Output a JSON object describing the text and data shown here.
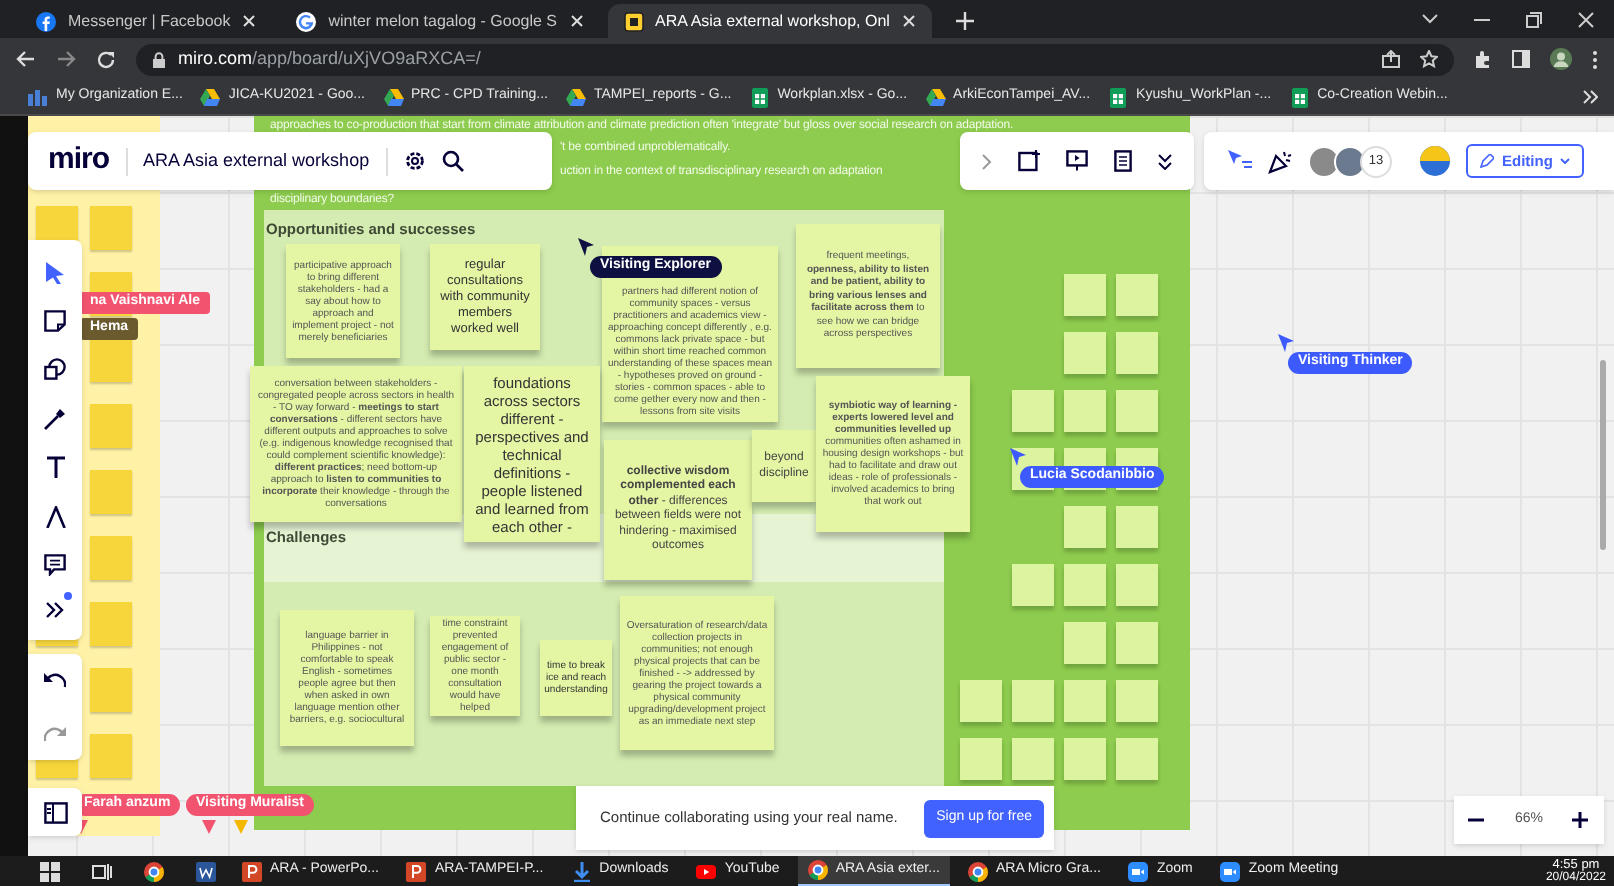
{
  "browser": {
    "tabs": [
      {
        "kind": "facebook",
        "label": "Messenger | Facebook",
        "selected": false
      },
      {
        "kind": "google",
        "label": "winter melon tagalog - Google S",
        "selected": false
      },
      {
        "kind": "miro",
        "label": "ARA Asia external workshop, Onl",
        "selected": true
      }
    ],
    "address": {
      "host": "miro.com",
      "path": "/app/board/uXjVO9aRXCA=/"
    },
    "bookmarks": [
      {
        "kind": "org",
        "label": "My Organization E..."
      },
      {
        "kind": "drive",
        "label": "JICA-KU2021 - Goo..."
      },
      {
        "kind": "drive",
        "label": "PRC - CPD Training..."
      },
      {
        "kind": "drive",
        "label": "TAMPEI_reports - G..."
      },
      {
        "kind": "sheets",
        "label": "Workplan.xlsx - Go..."
      },
      {
        "kind": "drive",
        "label": "ArkiEconTampei_AV..."
      },
      {
        "kind": "sheets",
        "label": "Kyushu_WorkPlan -..."
      },
      {
        "kind": "sheets",
        "label": "Co-Creation Webin..."
      }
    ]
  },
  "board": {
    "logo": "miro",
    "title": "ARA Asia external workshop",
    "collaborator_count": "13",
    "mode": "Editing",
    "tools": [
      {
        "kind": "select",
        "selected": true,
        "notification": false
      },
      {
        "kind": "sticky",
        "selected": false,
        "notification": false
      },
      {
        "kind": "shapes",
        "selected": false,
        "notification": false
      },
      {
        "kind": "pen",
        "selected": false,
        "notification": false
      },
      {
        "kind": "text",
        "selected": false,
        "notification": false
      },
      {
        "kind": "font",
        "selected": false,
        "notification": false
      },
      {
        "kind": "comment",
        "selected": false,
        "notification": false
      },
      {
        "kind": "more",
        "selected": false,
        "notification": true
      }
    ],
    "frame_lines": [
      "approaches to co-production that start from climate attribution and climate prediction often 'integrate' but gloss over social research on adaptation.",
      "'t be combined unproblematically.",
      "uction in the context of transdisciplinary research on adaptation",
      "disciplinary boundaries?"
    ],
    "headings": [
      "Opportunities and successes",
      "Challenges"
    ],
    "stickies": [
      {
        "text": "participative approach to bring different stakeholders - had a say about how to approach and implement project - not merely beneficiaries"
      },
      {
        "text": "regular consultations with community members worked well"
      },
      {
        "text": "partners had different notion of community spaces - versus practitioners and academics view - approaching concept differently , e.g. commons lack private space - but within short time reached common understanding of these spaces mean - hypotheses proved on ground - stories - common spaces - able to come gether every now and then - lessons from site visits"
      },
      {
        "text": "frequent meetings, **openness, ability to listen and be patient, ability to bring various lenses and facilitate across them** to see how we can bridge across perspectives"
      },
      {
        "text": "conversation between stakeholders - congregated people across sectors in health - TO way forward - **meetings to start conversations** - different sectors have different outputs and approaches to solve (e.g. indigenous knowledge recognised that could complement scientific knowledge): **different practices**; need bottom-up approach to **listen to communities to incorporate** their knowledge - through the conversations"
      },
      {
        "text": "foundations across sectors different - perspectives and technical definitions - people listened and learned from each other -"
      },
      {
        "text": "**collective wisdom complemented each other** - differences between fields were not hindering - maximised outcomes"
      },
      {
        "text": "beyond discipline"
      },
      {
        "text": "**symbiotic way of learning - experts lowered level and communities levelled up** communities often ashamed in housing design workshops - but had to facilitate and draw out ideas - role of professionals - involved academics to bring that work out"
      },
      {
        "text": "language barrier in Philippines - not comfortable to speak English - sometimes people agree but then when asked in own language mention other barriers, e.g. sociocultural"
      },
      {
        "text": "time constraint prevented engagement of public sector - one month consultation would have helped"
      },
      {
        "text": "time to break ice and reach understanding"
      },
      {
        "text": "Oversaturation of research/data collection projects in communities; not enough physical projects that can be finished - -> addressed by gearing the project towards a physical community upgrading/development project as an immediate next step"
      }
    ],
    "cursors": [
      {
        "kind": "tag",
        "name": "na Vaishnavi Ale",
        "color": "#f2546f"
      },
      {
        "kind": "tag",
        "name": "Hema",
        "color": "#6b5a2e"
      },
      {
        "kind": "arrow",
        "name": "Visiting Explorer",
        "color": "#0d1040"
      },
      {
        "kind": "arrow",
        "name": "Lucia Scodanibbio",
        "color": "#3d5afe"
      },
      {
        "kind": "arrow",
        "name": "Visiting Thinker",
        "color": "#3d5afe"
      },
      {
        "kind": "offscreen",
        "name": "Farah anzum",
        "color": "#f2546f"
      },
      {
        "kind": "offscreen",
        "name": "Visiting Muralist",
        "color": "#f2546f"
      },
      {
        "kind": "offscreen",
        "color": "#f5b800"
      }
    ],
    "signup": {
      "message": "Continue collaborating using your real name.",
      "button": "Sign up for free"
    },
    "zoom": "66%"
  },
  "taskbar": {
    "apps": [
      {
        "kind": "windows",
        "selected": false
      },
      {
        "kind": "taskview",
        "selected": false
      },
      {
        "kind": "chrome",
        "selected": false
      },
      {
        "kind": "word",
        "selected": false
      },
      {
        "kind": "powerpoint",
        "label": "ARA - PowerPo...",
        "selected": false
      },
      {
        "kind": "powerpoint",
        "label": "ARA-TAMPEI-P...",
        "selected": false
      },
      {
        "kind": "downloads",
        "label": "Downloads",
        "selected": false
      },
      {
        "kind": "youtube",
        "label": "YouTube",
        "selected": false
      },
      {
        "kind": "chrome",
        "label": "ARA Asia exter...",
        "selected": true
      },
      {
        "kind": "chrome",
        "label": "ARA Micro Gra...",
        "selected": false
      },
      {
        "kind": "zoom",
        "label": "Zoom",
        "selected": false
      },
      {
        "kind": "zoom",
        "label": "Zoom Meeting",
        "selected": false
      }
    ],
    "time": "4:55 pm",
    "date": "20/04/2022"
  }
}
